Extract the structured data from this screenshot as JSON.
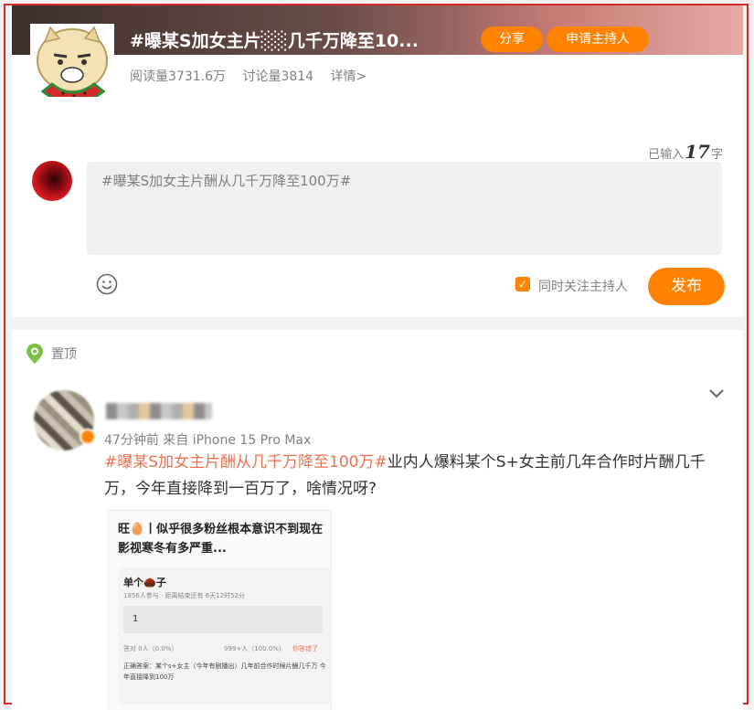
{
  "topic": {
    "title": "#曝某S加女主片酬从几千万降至100万#",
    "title_shown": "#曝某S加女主片░░几千万降至10...",
    "share_label": "分享",
    "apply_host_label": "申请主持人",
    "reads": "阅读量3731.6万",
    "discussions": "讨论量3814",
    "details": "详情>"
  },
  "composer": {
    "counter_prefix": "已输入",
    "counter_value": "17",
    "counter_suffix": "字",
    "text": "#曝某S加女主片酬从几千万降至100万#",
    "follow_host_label": "同时关注主持人",
    "follow_host_checked": true,
    "publish_label": "发布"
  },
  "feed": {
    "pinned_label": "置顶",
    "post": {
      "meta": "47分钟前  来自 iPhone 15 Pro Max",
      "hashtag": "#曝某S加女主片酬从几千万降至100万#",
      "body": "业内人爆料某个S+女主前几年合作时片酬几千万，今年直接降到一百万了，啥情况呀?",
      "image": {
        "headline": "旺🥚丨似乎很多粉丝根本意识不到现在影视寒冬有多严重...",
        "question": "单个🌰子",
        "participants": "1856人参与 · 距离结束还有 6天12时52分",
        "option": "1",
        "result_left": "答对 0人（0.0%）",
        "result_mid": "999+人（100.0%）",
        "result_right": "你答错了",
        "answer": "正确答案：某个s+女主（今年有剧播出）几年前合作时候片酬几千万 今年直接降到100万"
      }
    }
  },
  "colors": {
    "accent": "#ff8200",
    "hashtag": "#eb7350",
    "frame": "#d42a2a"
  }
}
